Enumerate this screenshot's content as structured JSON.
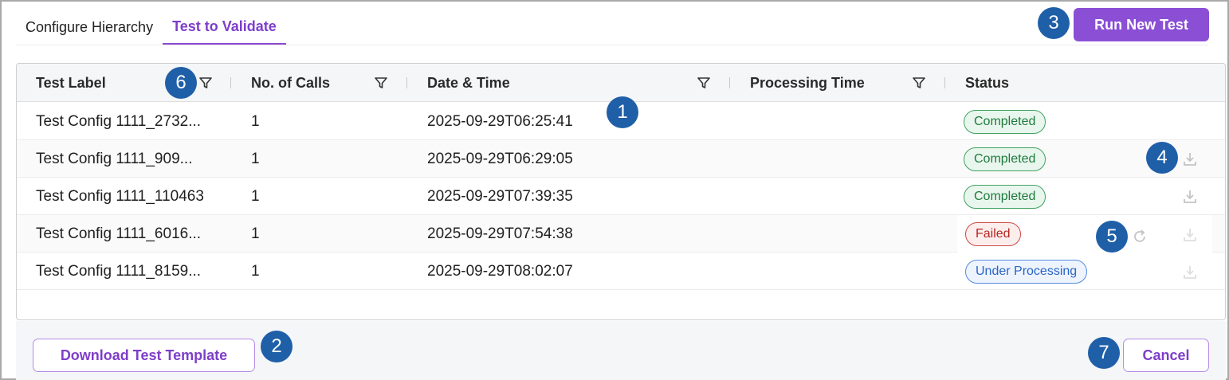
{
  "tabs": [
    {
      "label": "Configure Hierarchy",
      "active": false
    },
    {
      "label": "Test to Validate",
      "active": true
    }
  ],
  "actions": {
    "run_new_test": "Run New Test",
    "download_template": "Download Test Template",
    "cancel": "Cancel"
  },
  "table": {
    "columns": [
      "Test Label",
      "No. of Calls",
      "Date & Time",
      "Processing Time",
      "Status"
    ],
    "rows": [
      {
        "label": "Test Config 1111_2732...",
        "calls": "1",
        "datetime": "2025-09-29T06:25:41",
        "processing_time": "",
        "status": "Completed"
      },
      {
        "label": "Test Config 1111_909...",
        "calls": "1",
        "datetime": "2025-09-29T06:29:05",
        "processing_time": "",
        "status": "Completed"
      },
      {
        "label": "Test Config 1111_110463",
        "calls": "1",
        "datetime": "2025-09-29T07:39:35",
        "processing_time": "",
        "status": "Completed"
      },
      {
        "label": "Test Config 1111_6016...",
        "calls": "1",
        "datetime": "2025-09-29T07:54:38",
        "processing_time": "",
        "status": "Failed"
      },
      {
        "label": "Test Config 1111_8159...",
        "calls": "1",
        "datetime": "2025-09-29T08:02:07",
        "processing_time": "",
        "status": "Under Processing"
      }
    ]
  },
  "callouts": [
    "1",
    "2",
    "3",
    "4",
    "5",
    "6",
    "7"
  ],
  "icons": {
    "filter": "filter-icon",
    "download": "download-icon",
    "retry": "refresh-icon"
  },
  "colors": {
    "accent": "#8b4fd6",
    "callout": "#1f5fa8",
    "completed": "#1e7a3c",
    "failed": "#b3261e",
    "processing": "#2a65c6"
  }
}
